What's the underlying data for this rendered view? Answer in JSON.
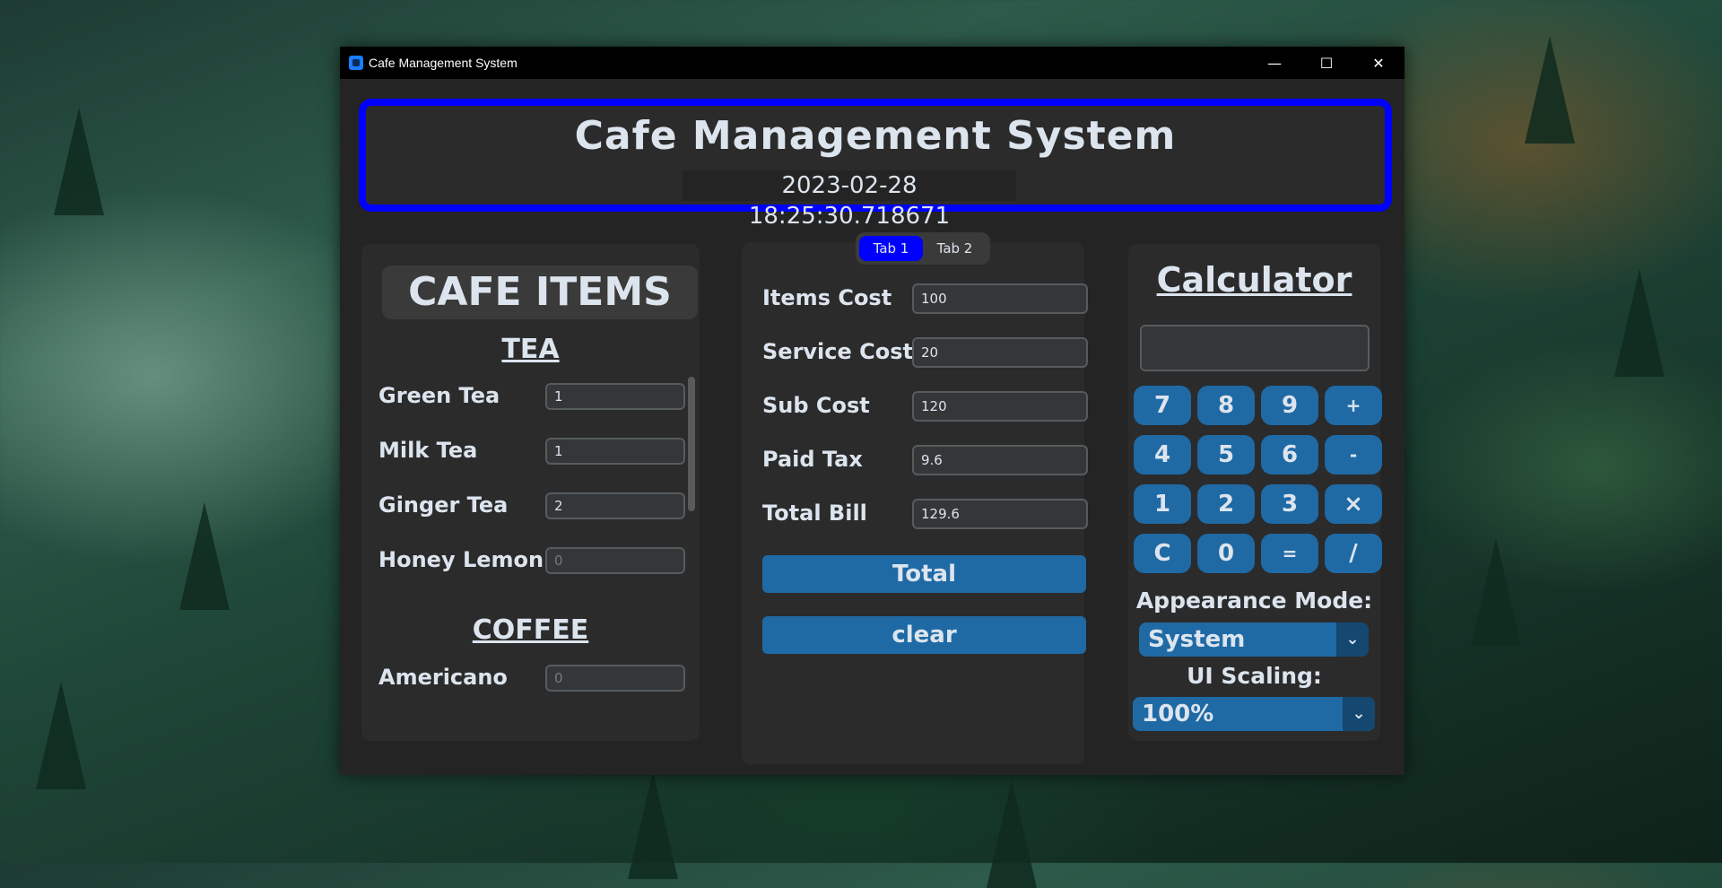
{
  "window": {
    "title": "Cafe Management System",
    "controls": {
      "minimize": "—",
      "maximize": "☐",
      "close": "✕"
    }
  },
  "header": {
    "title": "Cafe Management System",
    "datetime": "2023-02-28 18:25:30.718671"
  },
  "left": {
    "title": "CAFE ITEMS",
    "tea_heading": "TEA",
    "coffee_heading": "COFFEE",
    "items": [
      {
        "label": "Green Tea",
        "value": "1"
      },
      {
        "label": "Milk Tea",
        "value": "1"
      },
      {
        "label": "Ginger Tea",
        "value": "2"
      },
      {
        "label": "Honey Lemon",
        "value": "0"
      },
      {
        "label": "Americano",
        "value": "0"
      }
    ]
  },
  "tabs": [
    {
      "label": "Tab 1",
      "active": true
    },
    {
      "label": "Tab 2",
      "active": false
    }
  ],
  "costs": [
    {
      "label": "Items Cost",
      "value": "100"
    },
    {
      "label": "Service Cost",
      "value": "20"
    },
    {
      "label": "Sub Cost",
      "value": "120"
    },
    {
      "label": "Paid Tax",
      "value": "9.6"
    },
    {
      "label": "Total Bill",
      "value": "129.6"
    }
  ],
  "buttons": {
    "total": "Total",
    "clear": "clear"
  },
  "calculator": {
    "title": "Calculator",
    "display": "",
    "keys": [
      "7",
      "8",
      "9",
      "+",
      "4",
      "5",
      "6",
      "-",
      "1",
      "2",
      "3",
      "×",
      "C",
      "0",
      "=",
      "/"
    ]
  },
  "appearance": {
    "label": "Appearance Mode:",
    "value": "System"
  },
  "scaling": {
    "label": "UI Scaling:",
    "value": "100%"
  },
  "colors": {
    "accent": "#1f6aa5",
    "header_border": "#0000ff",
    "tab_active": "#0000ff"
  }
}
